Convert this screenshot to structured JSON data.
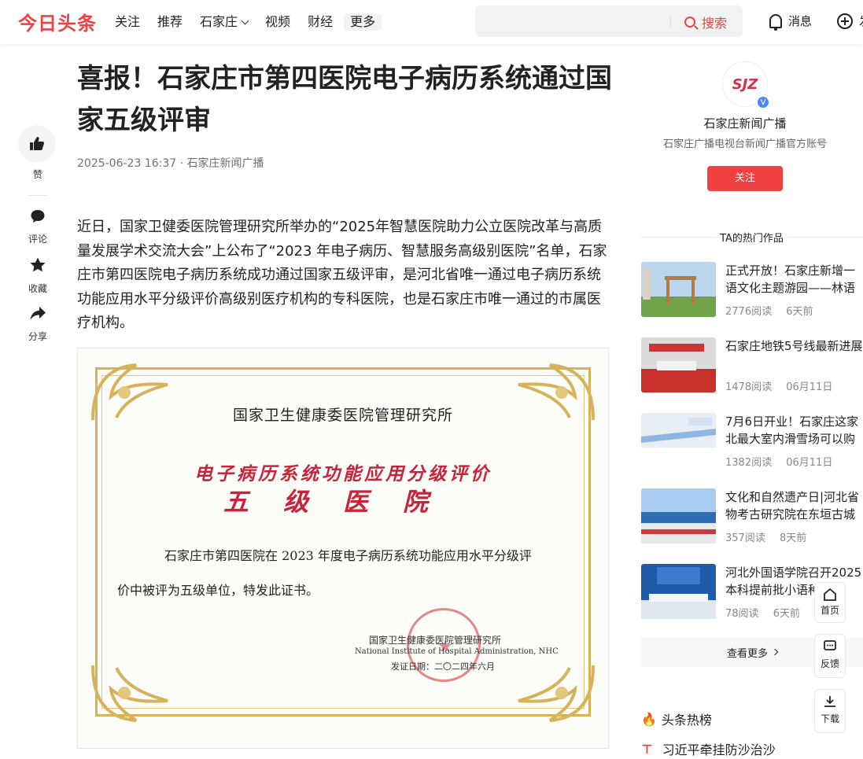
{
  "header": {
    "logo": "今日头条",
    "nav": [
      "关注",
      "推荐",
      "石家庄",
      "视频",
      "财经",
      "更多"
    ],
    "search_button": "搜索",
    "search_placeholder": "",
    "messages": "消息",
    "publish": "发"
  },
  "rail": {
    "like": "赞",
    "comment": "评论",
    "collect": "收藏",
    "share": "分享"
  },
  "article": {
    "title": "喜报！石家庄市第四医院电子病历系统通过国家五级评审",
    "date": "2025-06-23 16:37",
    "source": "石家庄新闻广播",
    "paragraph": "近日，国家卫健委医院管理研究所举办的“2025年智慧医院助力公立医院改革与高质量发展学术交流大会”上公布了“2023 年电子病历、智慧服务高级别医院”名单，石家庄市第四医院电子病历系统成功通过国家五级评审，是河北省唯一通过电子病历系统功能应用水平分级评价高级别医疗机构的专科医院，也是石家庄市唯一通过的市属医疗机构。"
  },
  "certificate": {
    "org": "国家卫生健康委医院管理研究所",
    "red_line1": "电子病历系统功能应用分级评价",
    "red_line2": "五级医院",
    "body1": "石家庄市第四医院在 2023 年度电子病历系统功能应用水平分级评",
    "body2": "价中被评为五级单位，特发此证书。",
    "sign_org": "国家卫生健康委医院管理研究所",
    "sign_en": "National Institute of Hospital Administration, NHC",
    "issue_date": "发证日期：二〇二四年六月"
  },
  "author": {
    "name": "石家庄新闻广播",
    "description": "石家庄广播电视台新闻广播官方账号",
    "follow": "关注",
    "avatar_text": "SJZ"
  },
  "hot_works": {
    "title": "TA的热门作品",
    "items": [
      {
        "title": "正式开放！石家庄新增一",
        "title2": "语文化主题游园——林语",
        "reads": "2776阅读",
        "time": "6天前"
      },
      {
        "title": "石家庄地铁5号线最新进展",
        "title2": "",
        "reads": "1478阅读",
        "time": "06月11日"
      },
      {
        "title": "7月6日开业！石家庄这家",
        "title2": "北最大室内滑雪场可以购",
        "reads": "1382阅读",
        "time": "06月11日"
      },
      {
        "title": "文化和自然遗产日|河北省",
        "title2": "物考古研究院在东垣古城",
        "reads": "357阅读",
        "time": "8天前"
      },
      {
        "title": "河北外国语学院召开2025",
        "title2": "本科提前批小语种",
        "reads": "78阅读",
        "time": "6天前"
      }
    ],
    "see_more": "查看更多"
  },
  "toplist": {
    "title": "头条热榜",
    "pinned": "习近平牵挂防沙治沙"
  },
  "float_buttons": {
    "home": "首页",
    "feedback": "反馈",
    "download": "下载"
  },
  "colors": {
    "brand": "#f04142",
    "gold": "#d6b25a",
    "seal_red": "#c8233a"
  }
}
